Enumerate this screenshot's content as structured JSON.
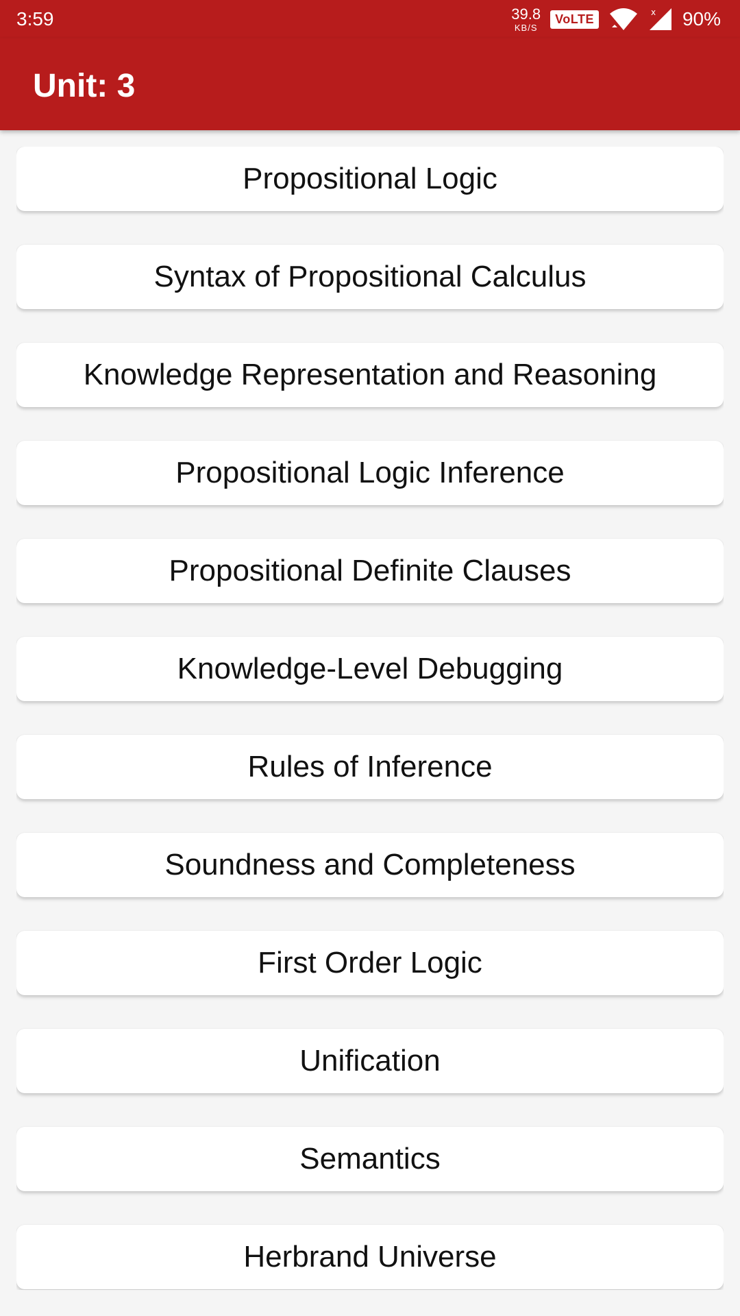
{
  "status_bar": {
    "time": "3:59",
    "net_speed_value": "39.8",
    "net_speed_unit": "KB/S",
    "volte": "VoLTE",
    "battery": "90%"
  },
  "app_bar": {
    "title": "Unit: 3"
  },
  "topics": [
    {
      "label": "Propositional Logic"
    },
    {
      "label": "Syntax of Propositional Calculus"
    },
    {
      "label": "Knowledge Representation and Reasoning"
    },
    {
      "label": "Propositional Logic Inference"
    },
    {
      "label": "Propositional Definite Clauses"
    },
    {
      "label": "Knowledge-Level Debugging"
    },
    {
      "label": "Rules of Inference"
    },
    {
      "label": "Soundness and Completeness"
    },
    {
      "label": "First Order Logic"
    },
    {
      "label": "Unification"
    },
    {
      "label": "Semantics"
    },
    {
      "label": "Herbrand Universe"
    }
  ],
  "colors": {
    "primary": "#b71c1c",
    "background": "#f5f5f5",
    "card": "#ffffff"
  },
  "icons": [
    "wifi-icon",
    "signal-icon"
  ]
}
